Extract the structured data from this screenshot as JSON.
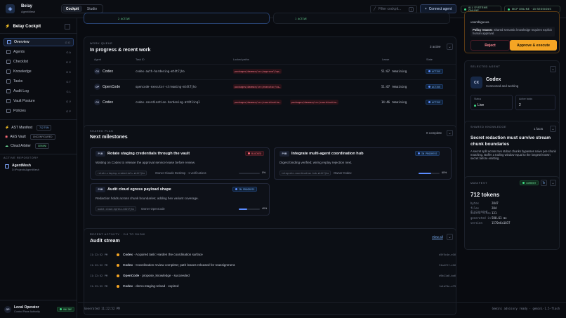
{
  "top": {
    "brand": "Belay",
    "brand_sub": "AgentMesh",
    "tabs": [
      "Cockpit",
      "Studio"
    ],
    "filter_placeholder": "Filter cockpit...",
    "filter_key": "/",
    "connect": "Connect agent",
    "systems": "ALL SYSTEMS ONLINE",
    "mcp": "MCP ONLINE · 15 SESSIONS"
  },
  "sidebar": {
    "title": "Belay Cockpit",
    "items": [
      {
        "label": "Overview",
        "key": "G O",
        "active": true
      },
      {
        "label": "Agents",
        "key": "G A"
      },
      {
        "label": "Checklist",
        "key": "G C"
      },
      {
        "label": "Knowledge",
        "key": "G K"
      },
      {
        "label": "Tasks",
        "key": "G T"
      },
      {
        "label": "Audit Log",
        "key": "G L"
      },
      {
        "label": "Vault Posture",
        "key": "G V"
      },
      {
        "label": "Policies",
        "key": "G P"
      }
    ],
    "status": [
      {
        "label": "AST Manifest",
        "chip": "712 TKN"
      },
      {
        "label": "AES Vault",
        "chip": "UNCONFIGURED"
      },
      {
        "label": "Cloud Arbiter",
        "chip": "GEMINI"
      }
    ],
    "repo_label": "ACTIVE REPOSITORY",
    "repo_name": "AgentMesh",
    "repo_path": "D:\\Projects\\AgentMesh",
    "user_name": "Local Operator",
    "user_role": "Control Plane Authority",
    "user_initials": "OP",
    "user_status": "ONLINE"
  },
  "top_strip": {
    "left_count": "2 ACTIVE",
    "right_count": "1 ACTIVE"
  },
  "work": {
    "eyebrow": "WORK QUEUE",
    "title": "In progress & recent work",
    "count": "3 active",
    "headers": [
      "Agent",
      "Task ID",
      "Locked paths",
      "Lease",
      "State"
    ],
    "rows": [
      {
        "initials": "CX",
        "agent": "Codex",
        "task": "codex-auth-hardening-mt4t7jho",
        "paths": [
          "packages/daemon/src/approval/ap…"
        ],
        "lease": "51:07 remaining",
        "state": "ACTIVE"
      },
      {
        "initials": "OP",
        "agent": "OpenCode",
        "task": "opencode-executor-streaming-mt4t7jho",
        "paths": [
          "packages/daemon/src/executor/co…"
        ],
        "lease": "51:07 remaining",
        "state": "ACTIVE"
      },
      {
        "initials": "CX",
        "agent": "Codex",
        "task": "codex-coordination-hardening-mt4t1inq1",
        "paths": [
          "packages/daemon/src/coordinatio…",
          "packages/daemon/src/coordinatio…"
        ],
        "lease": "14:46 remaining",
        "state": "ACTIVE"
      }
    ]
  },
  "plan": {
    "eyebrow": "SHARED PLAN",
    "title": "Next milestones",
    "count": "0 complete",
    "items": [
      {
        "tag": "P1B",
        "title": "Rotate staging credentials through the vault",
        "state": "BLOCKED",
        "desc": "Waiting on Codex to release the approval service lease before review.",
        "code": "rotate-staging-credentials-mt4t7jho",
        "owner": "Owner Claude Desktop · 1 verifications",
        "pct": "0%",
        "progress": 0
      },
      {
        "tag": "P0B",
        "title": "Integrate multi-agent coordination hub",
        "state": "IN PROGRESS",
        "desc": "Digest binding verified; wiring replay rejection next.",
        "code": "integrate-coordination-hub-mt4t7jho",
        "owner": "Owner Codex",
        "pct": "60%",
        "progress": 0.6
      },
      {
        "tag": "P0B",
        "title": "Audit cloud egress payload shape",
        "state": "IN PROGRESS",
        "desc": "Redaction holds across chunk boundaries; adding hex variant coverage.",
        "code": "audit-cloud-egress-mt4t7jho",
        "owner": "Owner OpenCode",
        "pct": "40%",
        "progress": 0.4
      }
    ]
  },
  "audit": {
    "eyebrow": "RECENT ACTIVITY · 2/4 TO SHOW",
    "title": "Audit stream",
    "view_all": "View all",
    "rows": [
      {
        "time": "11:22:52 PM",
        "agent": "Codex",
        "text": "· Acquired task: Harden the coordination surface",
        "hash": "d5f5c4e-e16"
      },
      {
        "time": "11:22:52 PM",
        "agent": "Codex",
        "text": "· Coordination review complete; path leases released for reassignment.",
        "hash": "31a4f2f-e16"
      },
      {
        "time": "11:22:52 PM",
        "agent": "OpenCode",
        "text": "· propose_knowledge · succeeded",
        "hash": "d9b11a8-bx6"
      },
      {
        "time": "11:22:52 PM",
        "agent": "Codex",
        "text": "· demo-staging-reload · expired",
        "hash": "fa1b74e-e79"
      }
    ]
  },
  "footer": {
    "left": "Generated 11:22:52 PM",
    "right": "Gemini advisory ready · gemini-1.5-flash"
  },
  "approval": {
    "text1": "unambiguous.",
    "policy_label": "Policy reason:",
    "policy_text": "Shared semantic knowledge requires explicit human approval.",
    "reject": "Reject",
    "approve": "Approve & execute"
  },
  "selected": {
    "eyebrow": "SELECTED AGENT",
    "initials": "CX",
    "name": "Codex",
    "sub": "Connected and working",
    "status_label": "Status",
    "status": "Live",
    "tasks_label": "Active tasks",
    "tasks": "2"
  },
  "knowledge": {
    "eyebrow": "SHARED KNOWLEDGE",
    "count": "1 facts",
    "title": "Secret redaction must survive stream chunk boundaries",
    "body": "A secret split across two stdout chunks bypasses naive per-chunk matching. Buffer a trailing window equal to the longest known secret before emitting."
  },
  "manifest": {
    "eyebrow": "MANIFEST",
    "state": "CURRENT",
    "tokens": "712 tokens",
    "rows": [
      [
        "bytes",
        "2847"
      ],
      [
        "files discovered",
        "284"
      ],
      [
        "source files",
        "131"
      ],
      [
        "generated in",
        "580.61 ms"
      ],
      [
        "version",
        "1570e6a1037"
      ]
    ]
  }
}
